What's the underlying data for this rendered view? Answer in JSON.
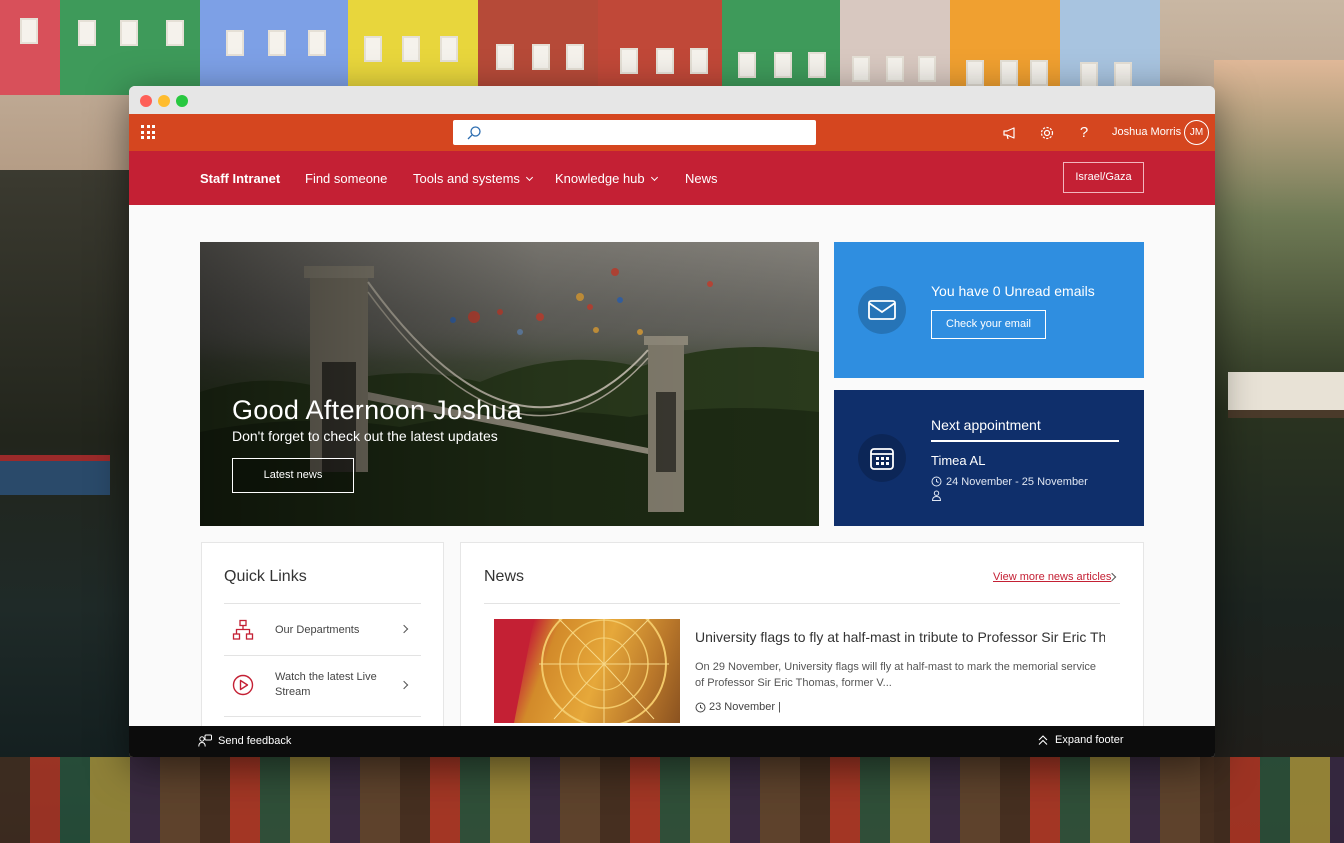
{
  "suite_bar": {
    "search_placeholder": "",
    "user_name": "Joshua Morris",
    "user_initials": "JM",
    "help_glyph": "?",
    "icons": [
      "waffle-icon",
      "search-icon",
      "megaphone-icon",
      "gear-icon",
      "help-icon"
    ]
  },
  "nav": {
    "brand": "Staff Intranet",
    "items": [
      {
        "label": "Find someone",
        "has_dropdown": false
      },
      {
        "label": "Tools and systems",
        "has_dropdown": true
      },
      {
        "label": "Knowledge hub",
        "has_dropdown": true
      },
      {
        "label": "News",
        "has_dropdown": false
      }
    ],
    "button": "Israel/Gaza"
  },
  "hero": {
    "title": "Good Afternoon Joshua",
    "subtitle": "Don't forget to check out the latest updates",
    "button": "Latest news"
  },
  "email_card": {
    "title": "You have 0 Unread emails",
    "button": "Check your email"
  },
  "appointment_card": {
    "title": "Next appointment",
    "name": "Timea AL",
    "date_range": "24 November - 25 November"
  },
  "quick_links": {
    "title": "Quick Links",
    "items": [
      {
        "label": "Our Departments",
        "icon": "org-chart-icon"
      },
      {
        "label": "Watch the latest Live Stream",
        "icon": "play-circle-icon"
      }
    ]
  },
  "news": {
    "title": "News",
    "more_link": "View more news articles",
    "article": {
      "headline": "University flags to fly at half-mast in tribute to Professor Sir Eric Th...",
      "summary": "On 29 November, University flags will fly at half-mast to mark the memorial service of Professor Sir Eric Thomas, former V...",
      "date": "23 November |"
    }
  },
  "footer": {
    "feedback": "Send feedback",
    "expand": "Expand footer"
  },
  "colors": {
    "suite_bar": "#d5461f",
    "nav_bar": "#c42034",
    "email_card": "#2f8ee0",
    "appointment_card": "#0f2f6b",
    "footer": "#0c0c0c",
    "link": "#c42034"
  }
}
